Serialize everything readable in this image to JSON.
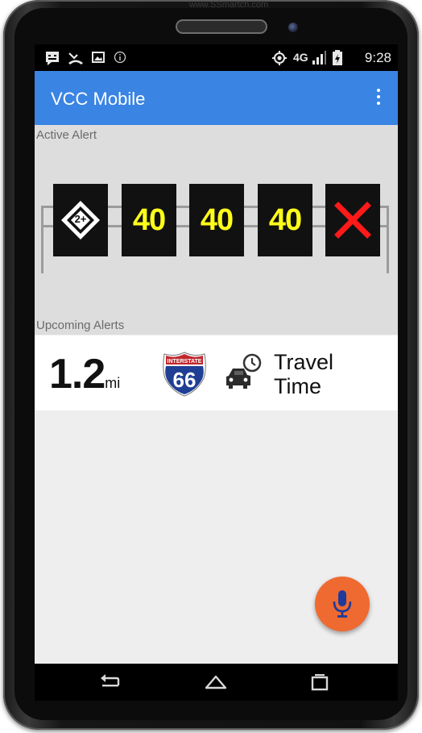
{
  "watermark": "www.SSmartch.com",
  "status_bar": {
    "time": "9:28",
    "network": "4G",
    "left_icons": [
      "message-icon",
      "missed-call-icon",
      "image-icon",
      "info-icon"
    ],
    "right_icons": [
      "location-icon",
      "signal-icon",
      "battery-charging-icon"
    ]
  },
  "app_bar": {
    "title": "VCC Mobile",
    "menu_icon": "more-vertical-icon",
    "color": "#3a84e3"
  },
  "active_alert": {
    "label": "Active Alert",
    "signs": [
      {
        "type": "hov",
        "text": "2+"
      },
      {
        "type": "speed",
        "text": "40"
      },
      {
        "type": "speed",
        "text": "40"
      },
      {
        "type": "speed",
        "text": "40"
      },
      {
        "type": "lane-closed",
        "icon": "red-x-icon"
      }
    ]
  },
  "upcoming": {
    "label": "Upcoming Alerts",
    "distance_value": "1.2",
    "distance_unit": "mi",
    "shield": {
      "top_text": "INTERSTATE",
      "number": "66"
    },
    "alert_text_line1": "Travel",
    "alert_text_line2": "Time"
  },
  "fab": {
    "icon": "microphone-icon",
    "color": "#ef6a30"
  },
  "nav_bar": {
    "icons": [
      "back-icon",
      "home-icon",
      "recent-apps-icon"
    ]
  }
}
